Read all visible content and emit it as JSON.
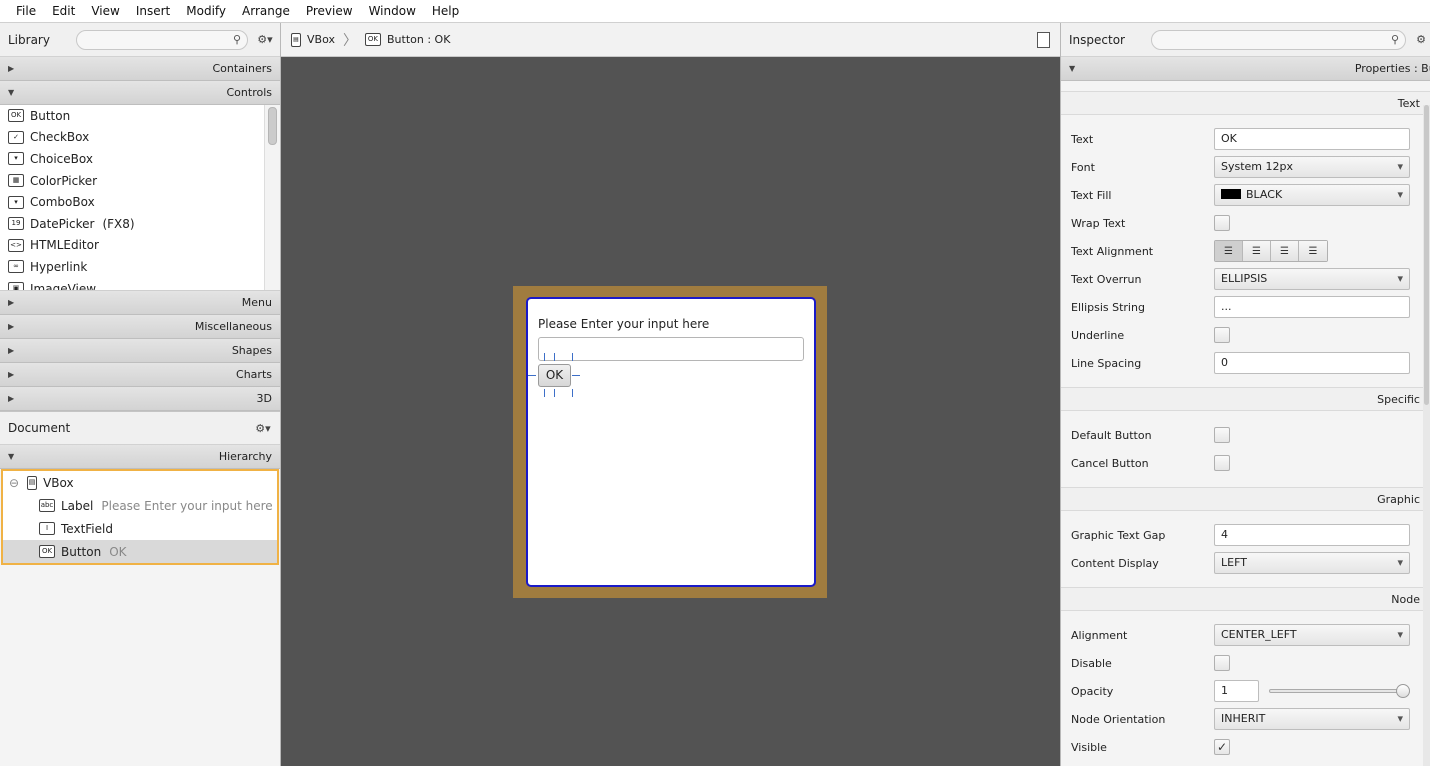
{
  "menu": [
    "File",
    "Edit",
    "View",
    "Insert",
    "Modify",
    "Arrange",
    "Preview",
    "Window",
    "Help"
  ],
  "library": {
    "title": "Library",
    "search_placeholder": "",
    "gear": "⚙▾",
    "sections_top": [
      {
        "label": "Containers",
        "collapsed": true
      },
      {
        "label": "Controls",
        "collapsed": false
      }
    ],
    "controls": [
      {
        "icon": "OK",
        "label": "Button",
        "extra": ""
      },
      {
        "icon": "✓",
        "label": "CheckBox",
        "extra": ""
      },
      {
        "icon": "▾",
        "label": "ChoiceBox",
        "extra": ""
      },
      {
        "icon": "▦",
        "label": "ColorPicker",
        "extra": ""
      },
      {
        "icon": "▾",
        "label": "ComboBox",
        "extra": ""
      },
      {
        "icon": "19",
        "label": "DatePicker",
        "extra": "(FX8)"
      },
      {
        "icon": "<>",
        "label": "HTMLEditor",
        "extra": ""
      },
      {
        "icon": "∞",
        "label": "Hyperlink",
        "extra": ""
      },
      {
        "icon": "▣",
        "label": "ImageView",
        "extra": ""
      }
    ],
    "sections_bottom": [
      {
        "label": "Menu"
      },
      {
        "label": "Miscellaneous"
      },
      {
        "label": "Shapes"
      },
      {
        "label": "Charts"
      },
      {
        "label": "3D"
      }
    ]
  },
  "document": {
    "title": "Document",
    "gear": "⚙▾",
    "section": "Hierarchy",
    "tree": [
      {
        "icon": "▤",
        "label": "VBox",
        "detail": "",
        "level": 0
      },
      {
        "icon": "abc",
        "label": "Label",
        "detail": "Please Enter your input here",
        "level": 1
      },
      {
        "icon": "I",
        "label": "TextField",
        "detail": "",
        "level": 1
      },
      {
        "icon": "OK",
        "label": "Button",
        "detail": "OK",
        "level": 1
      }
    ]
  },
  "breadcrumb": {
    "first": "VBox",
    "second_icon": "OK",
    "second": "Button : OK"
  },
  "canvas": {
    "label_text": "Please Enter your input here",
    "button_text": "OK"
  },
  "inspector": {
    "title": "Inspector",
    "header": "Properties : Button",
    "sections": [
      {
        "title": "Text",
        "rows": [
          {
            "label": "Text",
            "type": "text",
            "value": "OK"
          },
          {
            "label": "Font",
            "type": "combo",
            "value": "System 12px"
          },
          {
            "label": "Text Fill",
            "type": "color",
            "value": "BLACK",
            "color": "#000000"
          },
          {
            "label": "Wrap Text",
            "type": "check",
            "value": ""
          },
          {
            "label": "Text Alignment",
            "type": "align",
            "value": ""
          },
          {
            "label": "Text Overrun",
            "type": "combo",
            "value": "ELLIPSIS"
          },
          {
            "label": "Ellipsis String",
            "type": "text",
            "value": "..."
          },
          {
            "label": "Underline",
            "type": "check",
            "value": ""
          },
          {
            "label": "Line Spacing",
            "type": "text",
            "value": "0"
          }
        ]
      },
      {
        "title": "Specific",
        "rows": [
          {
            "label": "Default Button",
            "type": "check",
            "value": ""
          },
          {
            "label": "Cancel Button",
            "type": "check",
            "value": ""
          }
        ]
      },
      {
        "title": "Graphic",
        "rows": [
          {
            "label": "Graphic Text Gap",
            "type": "text",
            "value": "4"
          },
          {
            "label": "Content Display",
            "type": "combo",
            "value": "LEFT"
          }
        ]
      },
      {
        "title": "Node",
        "rows": [
          {
            "label": "Alignment",
            "type": "combo",
            "value": "CENTER_LEFT"
          },
          {
            "label": "Disable",
            "type": "check",
            "value": ""
          },
          {
            "label": "Opacity",
            "type": "slider",
            "value": "1",
            "level": 1
          },
          {
            "label": "Node Orientation",
            "type": "combo",
            "value": "INHERIT"
          },
          {
            "label": "Visible",
            "type": "check",
            "value": "✓"
          }
        ]
      }
    ]
  }
}
